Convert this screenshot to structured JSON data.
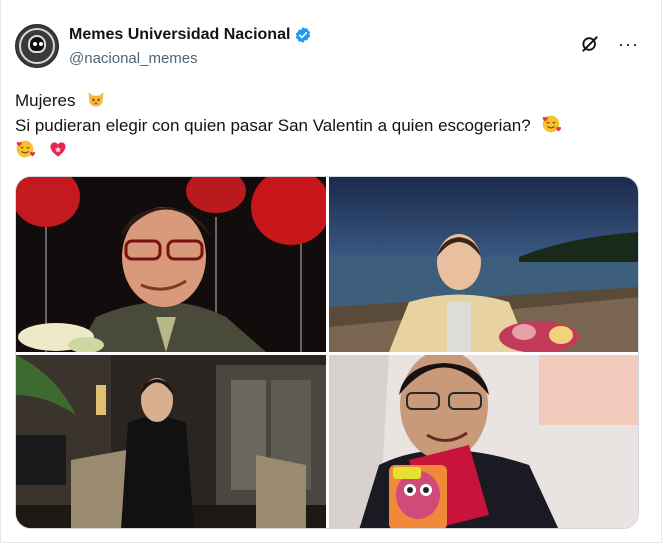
{
  "account": {
    "display_name": "Memes Universidad Nacional",
    "handle": "@nacional_memes",
    "verified": true,
    "verified_color": "#1d9bf0"
  },
  "post": {
    "line1": "Mujeres",
    "line2": "Si pudieran elegir con quien pasar San Valentin a quien escogerian?",
    "emojis": [
      "cat-face-emoji",
      "smiling-face-with-hearts-emoji",
      "smiling-face-with-hearts-emoji",
      "heart-emoji"
    ]
  },
  "actions": {
    "grok_icon": "grok-icon",
    "more_icon": "more-options-icon",
    "more_label": "···"
  },
  "media": {
    "images": [
      {
        "name": "photo-man-glasses-red-balloons"
      },
      {
        "name": "photo-man-beach-dinner"
      },
      {
        "name": "photo-man-black-suit-hotel"
      },
      {
        "name": "photo-man-glasses-furby-gift"
      }
    ]
  },
  "colors": {
    "text": "#0f1419",
    "secondary": "#536471",
    "accent": "#1d9bf0"
  }
}
